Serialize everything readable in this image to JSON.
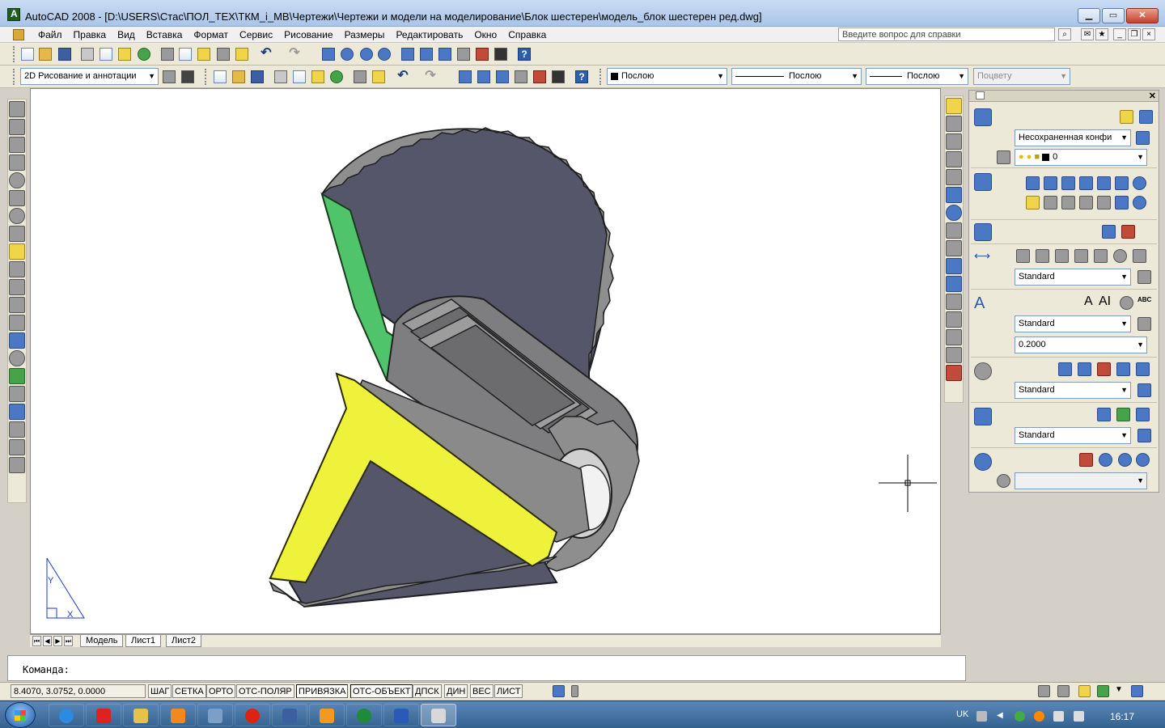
{
  "window": {
    "title": "AutoCAD 2008 - [D:\\USERS\\Стас\\ПОЛ_ТЕХ\\ТКМ_i_МВ\\Чертежи\\Чертежи и модели на моделирование\\Блок шестерен\\модель_блок шестерен ред.dwg]",
    "minimize": "▁",
    "maximize": "▭",
    "close": "✕"
  },
  "menu": {
    "items": [
      "Файл",
      "Правка",
      "Вид",
      "Вставка",
      "Формат",
      "Сервис",
      "Рисование",
      "Размеры",
      "Редактировать",
      "Окно",
      "Справка"
    ],
    "help_placeholder": "Введите вопрос для справки"
  },
  "toolbar2": {
    "workspace": "2D Рисование и аннотации",
    "color": "Послою",
    "linetype": "Послою",
    "lineweight": "Послою",
    "plotstyle": "Поцвету"
  },
  "dashboard": {
    "layer_state": "Несохраненная конфи",
    "layer_current": "0",
    "dim_style": "Standard",
    "text_style": "Standard",
    "text_height": "0.2000",
    "mleader_style": "Standard",
    "table_style": "Standard",
    "text_icons": [
      "A",
      "AI",
      "ABC"
    ]
  },
  "layout_tabs": [
    "Модель",
    "Лист1",
    "Лист2"
  ],
  "active_tab": "Лист1",
  "ucs": {
    "x": "X",
    "y": "Y"
  },
  "command": {
    "prompt": "Команда:"
  },
  "status": {
    "coords": "8.4070, 3.0752, 0.0000",
    "buttons": [
      "ШАГ",
      "СЕТКА",
      "ОРТО",
      "ОТС-ПОЛЯР",
      "ПРИВЯЗКА",
      "ОТС-ОБЪЕКТ",
      "ДПСК",
      "ДИН",
      "ВЕС",
      "ЛИСТ"
    ],
    "on": [
      "ПРИВЯЗКА",
      "ОТС-ОБЪЕКТ"
    ]
  },
  "taskbar": {
    "lang": "UK",
    "clock": "16:17",
    "apps": [
      "ie-icon",
      "acrobat-icon",
      "explorer-icon",
      "media-player-icon",
      "paint-icon",
      "opera-icon",
      "save-icon",
      "folder-icon",
      "excel-icon",
      "word-icon",
      "autocad-icon"
    ]
  },
  "colors": {
    "gear_face": "#56566a",
    "teeth": "#8e8e8e",
    "section_green": "#4fc46a",
    "section_yellow": "#eef23a",
    "bore": "#9a9a9a"
  }
}
